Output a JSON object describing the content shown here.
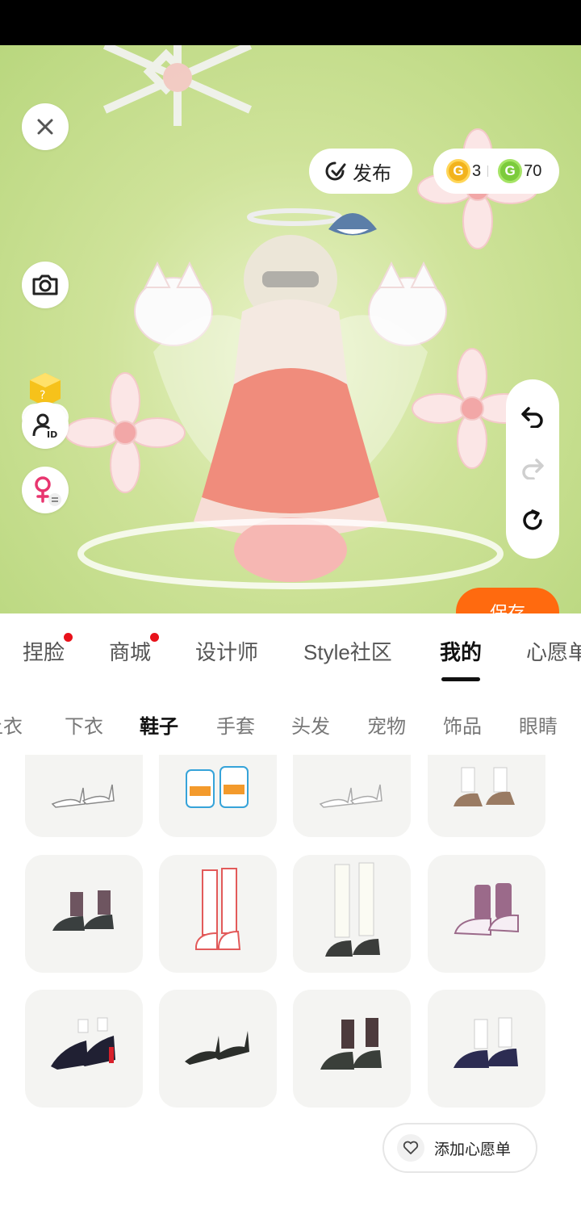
{
  "header": {
    "publish_label": "发布",
    "currency_gold": "3",
    "currency_green": "70",
    "mystery_box_label": "盲盒",
    "save_label": "保存"
  },
  "tabs": [
    {
      "label": "捏脸",
      "badge": true
    },
    {
      "label": "商城",
      "badge": true
    },
    {
      "label": "设计师",
      "badge": false
    },
    {
      "label": "Style社区",
      "badge": false
    },
    {
      "label": "我的",
      "badge": false,
      "active": true
    },
    {
      "label": "心愿单",
      "badge": false
    }
  ],
  "categories": [
    {
      "label": "上衣"
    },
    {
      "label": "下衣"
    },
    {
      "label": "鞋子",
      "active": true
    },
    {
      "label": "手套"
    },
    {
      "label": "头发"
    },
    {
      "label": "宠物"
    },
    {
      "label": "饰品"
    },
    {
      "label": "眼睛"
    }
  ],
  "items": [
    {
      "name": "white-heels"
    },
    {
      "name": "orange-blue-sneakers"
    },
    {
      "name": "white-heels-2"
    },
    {
      "name": "brown-loafers"
    },
    {
      "name": "dark-loafers-socks"
    },
    {
      "name": "white-red-boots"
    },
    {
      "name": "white-stockings-loafers"
    },
    {
      "name": "purple-high-top-sneakers"
    },
    {
      "name": "black-red-mary-janes"
    },
    {
      "name": "black-pumps"
    },
    {
      "name": "dark-loafers"
    },
    {
      "name": "navy-mary-janes"
    }
  ],
  "wishlist": {
    "label": "添加心愿单"
  },
  "colors": {
    "accent": "#ff6a0f",
    "badge": "#e8121b",
    "scene_bg": "#c3dd88"
  }
}
